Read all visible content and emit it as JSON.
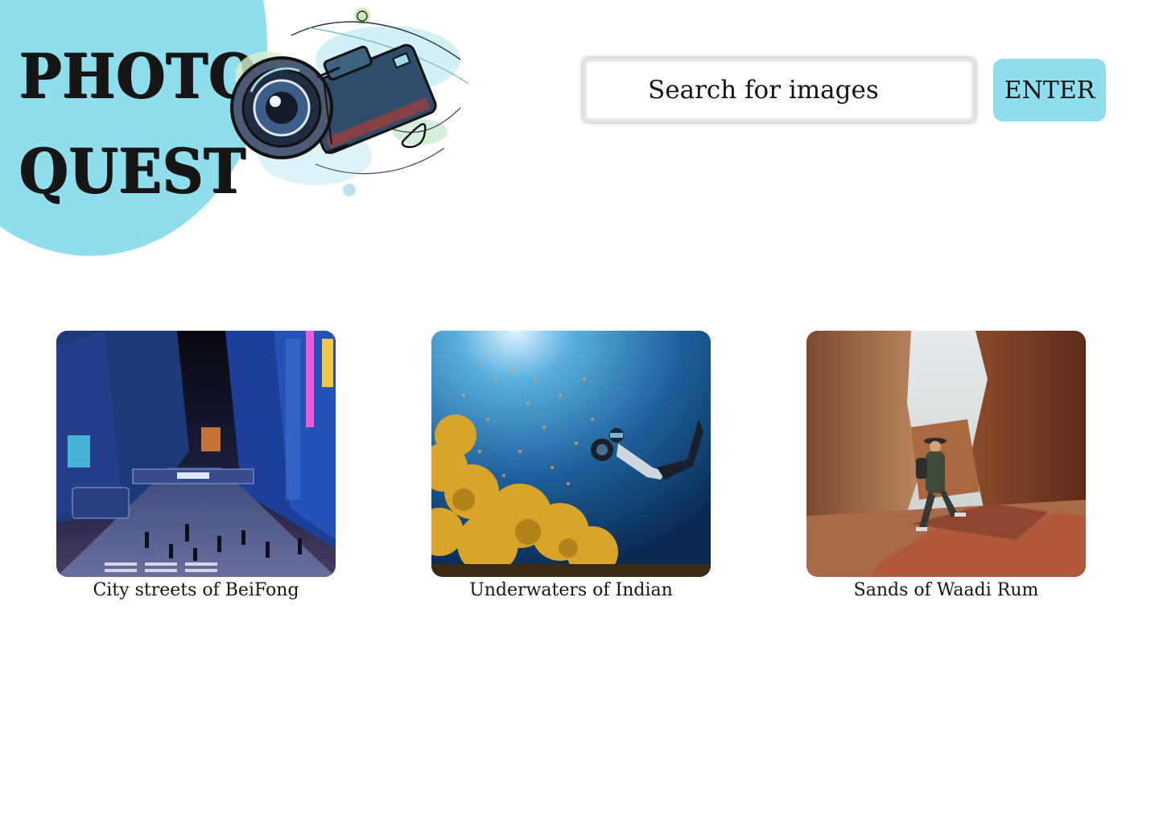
{
  "header": {
    "logo_line1": "PHOTO",
    "logo_line2": "QUEST",
    "logo_icon": "camera-icon",
    "brand_color": "#8fdeee"
  },
  "search": {
    "placeholder": "Search for images",
    "value": "",
    "button_label": "ENTER"
  },
  "gallery": {
    "items": [
      {
        "caption": "City streets of BeiFong",
        "image": "city-street-photo"
      },
      {
        "caption": "Underwaters of Indian",
        "image": "underwater-diver-photo"
      },
      {
        "caption": "Sands of Waadi Rum",
        "image": "desert-canyon-photo"
      }
    ]
  }
}
